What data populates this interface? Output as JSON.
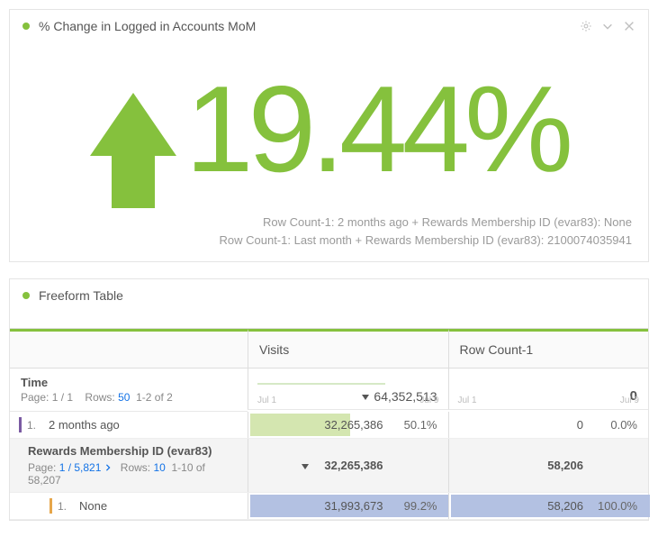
{
  "panels": {
    "pct_change": {
      "title": "% Change in Logged in Accounts MoM",
      "value": "19.44%",
      "direction": "up",
      "footnote1": "Row Count-1: 2 months ago + Rewards Membership ID (evar83): None",
      "footnote2": "Row Count-1: Last month + Rewards Membership ID (evar83): 2100074035941"
    },
    "freeform": {
      "title": "Freeform Table",
      "columns": {
        "visits": "Visits",
        "rowcount": "Row Count-1"
      },
      "time": {
        "label": "Time",
        "page_label": "Page:",
        "page_value": "1 / 1",
        "rows_label": "Rows:",
        "rows_value": "50",
        "range_text": "1-2 of 2"
      },
      "totals": {
        "visits": "64,352,513",
        "rowcount": "0"
      },
      "ticks": {
        "start": "Jul 1",
        "end": "Jul 9"
      },
      "row_two_months": {
        "num": "1.",
        "label": "2 months ago",
        "visits_val": "32,265,386",
        "visits_pct": "50.1%",
        "rowcount_val": "0",
        "rowcount_pct": "0.0%"
      },
      "nested": {
        "title": "Rewards Membership ID (evar83)",
        "page_label": "Page:",
        "page_value": "1 / 5,821",
        "rows_label": "Rows:",
        "rows_value": "10",
        "range_text": "1-10 of 58,207",
        "totals": {
          "visits": "32,265,386",
          "rowcount": "58,206"
        },
        "row_none": {
          "num": "1.",
          "label": "None",
          "visits_val": "31,993,673",
          "visits_pct": "99.2%",
          "rowcount_val": "58,206",
          "rowcount_pct": "100.0%"
        }
      }
    }
  }
}
